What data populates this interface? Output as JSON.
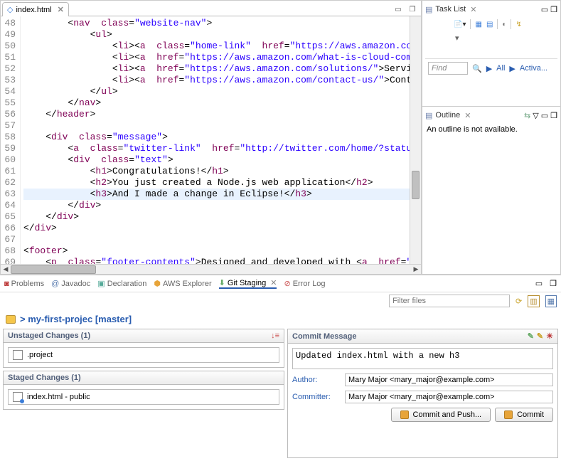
{
  "editor": {
    "tab": "index.html",
    "lineNumbers": [
      "48",
      "49",
      "50",
      "51",
      "52",
      "53",
      "54",
      "55",
      "56",
      "57",
      "58",
      "59",
      "60",
      "61",
      "62",
      "63",
      "64",
      "65",
      "66",
      "67",
      "68",
      "69"
    ],
    "code": [
      "        <nav class=\"website-nav\">",
      "            <ul>",
      "                <li><a class=\"home-link\" href=\"https://aws.amazon.com/\">",
      "                <li><a href=\"https://aws.amazon.com/what-is-cloud-comput",
      "                <li><a href=\"https://aws.amazon.com/solutions/\">Services",
      "                <li><a href=\"https://aws.amazon.com/contact-us/\">Contact",
      "            </ul>",
      "        </nav>",
      "    </header>",
      "",
      "    <div class=\"message\">",
      "        <a class=\"twitter-link\" href=\"http://twitter.com/home/?status=I",
      "        <div class=\"text\">",
      "            <h1>Congratulations!</h1>",
      "            <h2>You just created a Node.js web application</h2>",
      "            <h3>And I made a change in Eclipse!</h3>",
      "        </div>",
      "    </div>",
      "</div>",
      "",
      "<footer>",
      "    <p class=\"footer-contents\">Designed and developed with <a href=\"http"
    ],
    "currentLineIndex": 15
  },
  "taskList": {
    "title": "Task List",
    "findPlaceholder": "Find",
    "links": {
      "all": "All",
      "activate": "Activa..."
    }
  },
  "outline": {
    "title": "Outline",
    "empty": "An outline is not available."
  },
  "bottomViews": {
    "problems": "Problems",
    "javadoc": "Javadoc",
    "declaration": "Declaration",
    "aws": "AWS Explorer",
    "git": "Git Staging",
    "errorlog": "Error Log",
    "filterPlaceholder": "Filter files"
  },
  "gitStaging": {
    "repo": "> my-first-projec [master]",
    "unstaged": {
      "title": "Unstaged Changes (1)",
      "file": ".project"
    },
    "staged": {
      "title": "Staged Changes (1)",
      "file": "index.html - public"
    },
    "commit": {
      "title": "Commit Message",
      "message": "Updated index.html with a new h3",
      "authorLabel": "Author:",
      "author": "Mary Major <mary_major@example.com>",
      "committerLabel": "Committer:",
      "committer": "Mary Major <mary_major@example.com>",
      "btnCommitPush": "Commit and Push...",
      "btnCommit": "Commit"
    }
  }
}
